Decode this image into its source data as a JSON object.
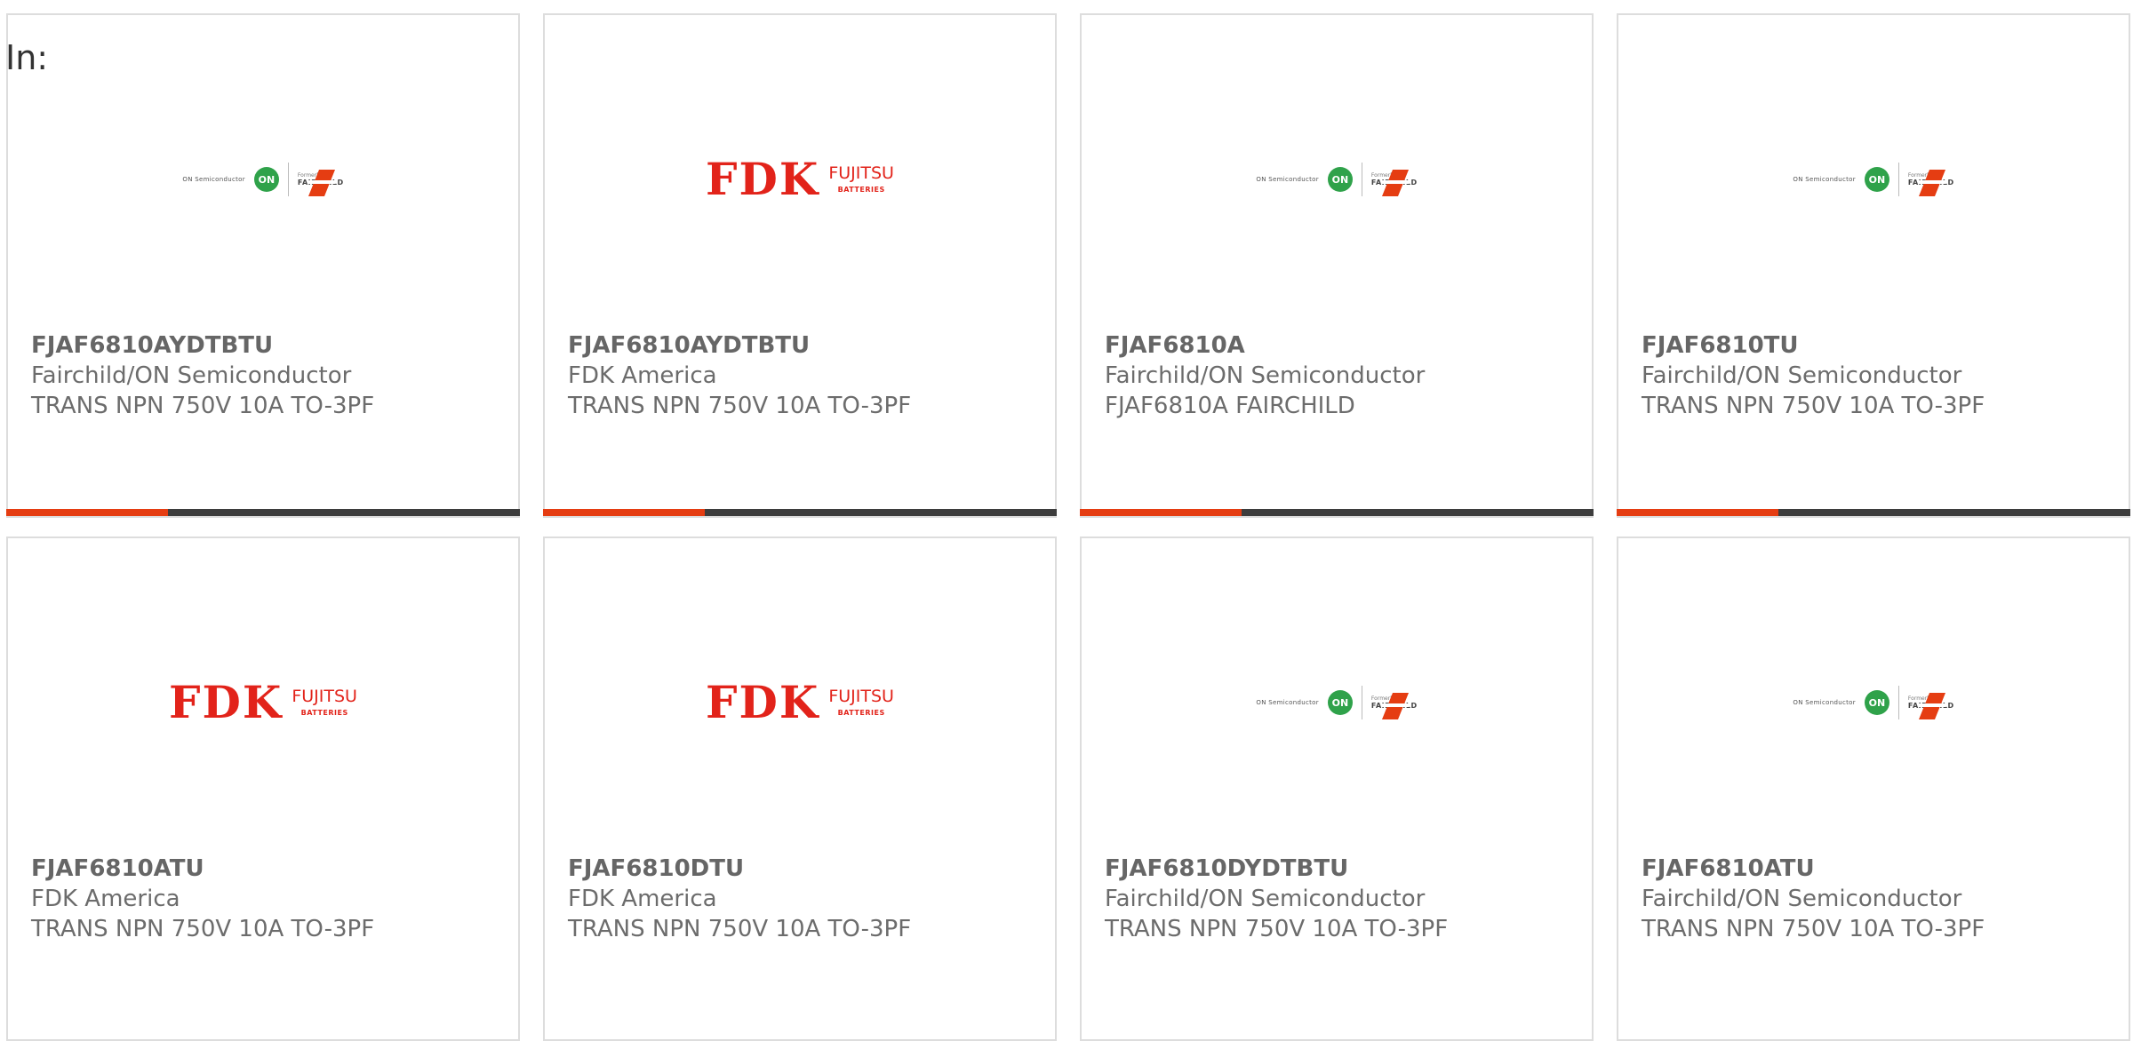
{
  "header": {
    "in_label": "In:"
  },
  "colors": {
    "accent": "#e53d12",
    "bar_dark": "#3d3d3d",
    "fdk_red": "#e2231a",
    "on_green": "#2fa24a"
  },
  "logos": {
    "on_fairchild": {
      "on_text": "ON Semiconductor",
      "on_badge": "ON",
      "formerly": "Formerly",
      "fairchild": "FAIRCHILD"
    },
    "fdk": {
      "brand": "FDK",
      "fujitsu": "FUJITSU",
      "batteries": "BATTERIES"
    }
  },
  "products": [
    {
      "part": "FJAF6810AYDTBTU",
      "manufacturer": "Fairchild/ON Semiconductor",
      "description": "TRANS NPN 750V 10A TO-3PF",
      "logo": "on-fairchild-logo"
    },
    {
      "part": "FJAF6810AYDTBTU",
      "manufacturer": "FDK America",
      "description": "TRANS NPN 750V 10A TO-3PF",
      "logo": "fdk-fujitsu-logo"
    },
    {
      "part": "FJAF6810A",
      "manufacturer": "Fairchild/ON Semiconductor",
      "description": "FJAF6810A FAIRCHILD",
      "logo": "on-fairchild-logo"
    },
    {
      "part": "FJAF6810TU",
      "manufacturer": "Fairchild/ON Semiconductor",
      "description": "TRANS NPN 750V 10A TO-3PF",
      "logo": "on-fairchild-logo"
    },
    {
      "part": "FJAF6810ATU",
      "manufacturer": "FDK America",
      "description": "TRANS NPN 750V 10A TO-3PF",
      "logo": "fdk-fujitsu-logo"
    },
    {
      "part": "FJAF6810DTU",
      "manufacturer": "FDK America",
      "description": "TRANS NPN 750V 10A TO-3PF",
      "logo": "fdk-fujitsu-logo"
    },
    {
      "part": "FJAF6810DYDTBTU",
      "manufacturer": "Fairchild/ON Semiconductor",
      "description": "TRANS NPN 750V 10A TO-3PF",
      "logo": "on-fairchild-logo"
    },
    {
      "part": "FJAF6810ATU",
      "manufacturer": "Fairchild/ON Semiconductor",
      "description": "TRANS NPN 750V 10A TO-3PF",
      "logo": "on-fairchild-logo"
    }
  ]
}
